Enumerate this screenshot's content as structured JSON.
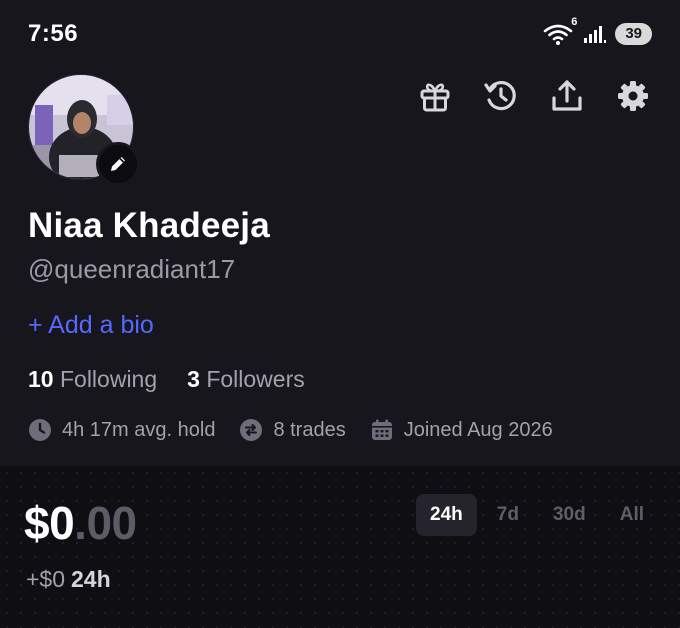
{
  "status_bar": {
    "time": "7:56",
    "network_badge": "6",
    "battery": "39"
  },
  "profile": {
    "name": "Niaa Khadeeja",
    "handle": "@queenradiant17",
    "bio_link": "+ Add a bio",
    "following_count": "10",
    "following_label": "Following",
    "followers_count": "3",
    "followers_label": "Followers"
  },
  "stats": {
    "avg_hold": "4h 17m avg. hold",
    "trades": "8 trades",
    "joined": "Joined Aug 2026"
  },
  "header_icons": [
    "gift-icon",
    "history-icon",
    "share-icon",
    "settings-icon"
  ],
  "portfolio": {
    "balance_whole": "$0",
    "balance_decimal": ".00",
    "change_value": "+$0",
    "change_period": "24h",
    "ranges": [
      "24h",
      "7d",
      "30d",
      "All"
    ],
    "active_range": "24h"
  },
  "colors": {
    "background": "#17161d",
    "panel": "#0e0e13",
    "accent": "#5568ff",
    "muted_text": "#a3a1ad"
  }
}
